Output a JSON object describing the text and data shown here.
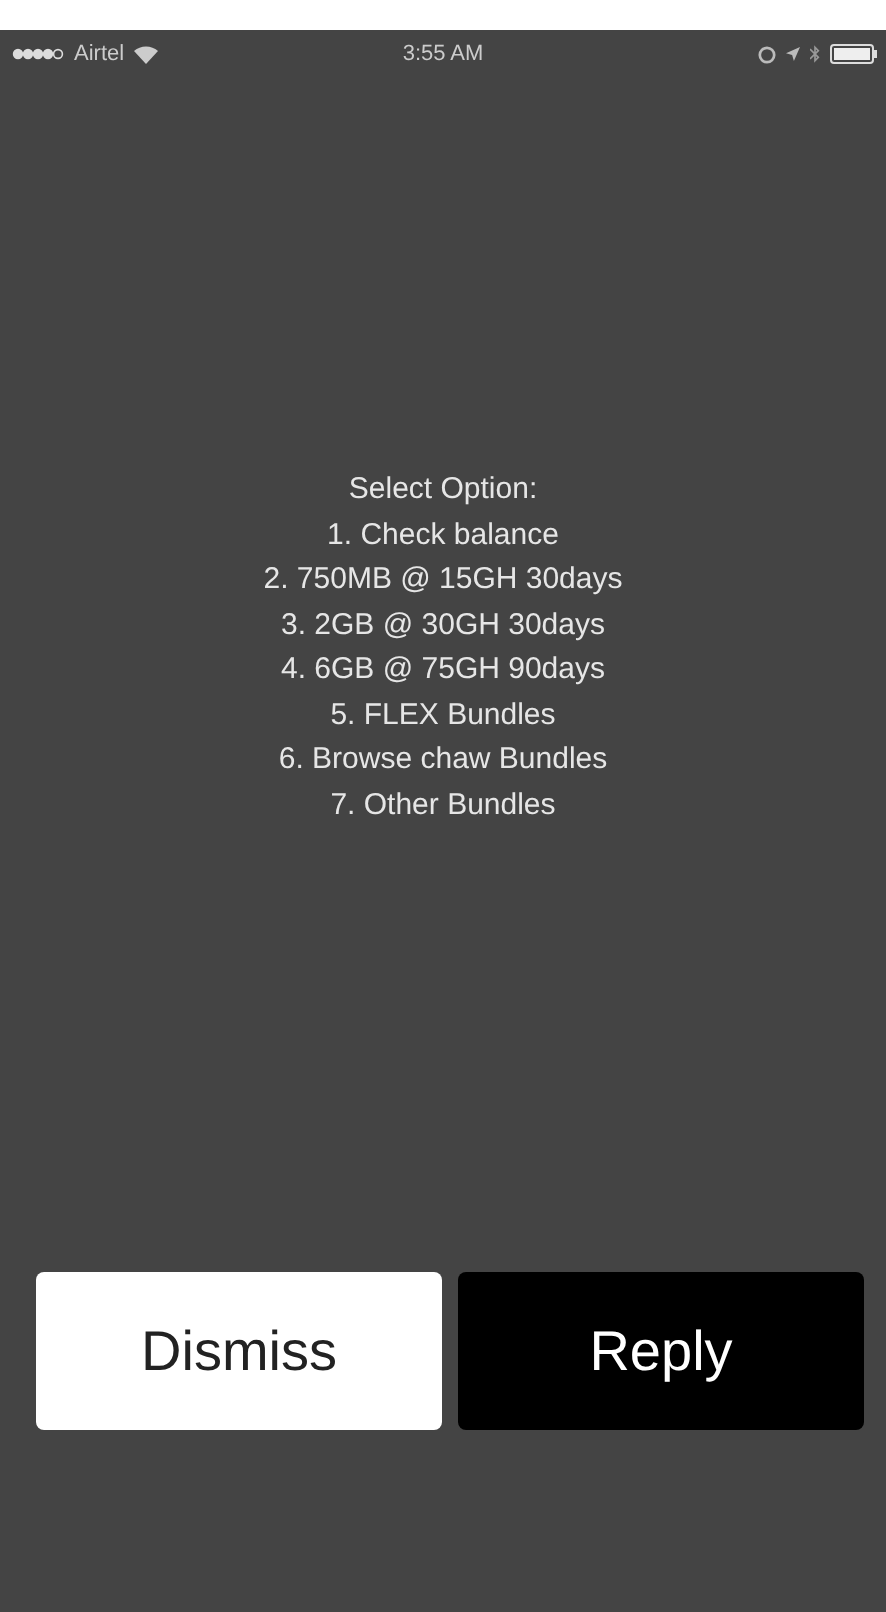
{
  "status_bar": {
    "carrier": "Airtel",
    "time": "3:55 AM"
  },
  "message": {
    "lines": [
      "Select Option:",
      "1. Check balance",
      "2. 750MB @ 15GH 30days",
      "3. 2GB @ 30GH 30days",
      "4. 6GB @ 75GH 90days",
      "5. FLEX Bundles",
      "6. Browse chaw Bundles",
      "7. Other Bundles"
    ]
  },
  "buttons": [
    {
      "label": "Dismiss",
      "kind": "light"
    },
    {
      "label": "Reply",
      "kind": "dark"
    }
  ]
}
